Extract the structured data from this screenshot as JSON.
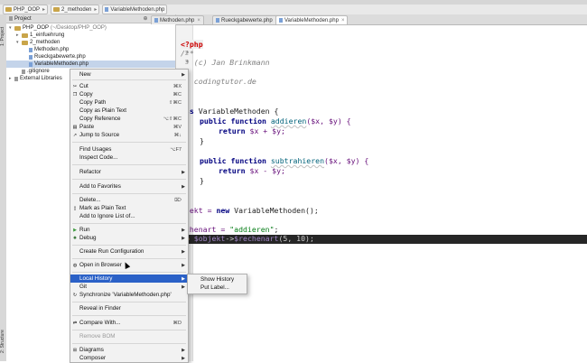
{
  "breadcrumbs": [
    "PHP_OOP",
    "2_methoden",
    "VariableMethoden.php"
  ],
  "project_panel": {
    "header": "Project",
    "tree": [
      {
        "label": "PHP_OOP",
        "path": "(~/Desktop/PHP_OOP)"
      },
      {
        "label": "1_einfuehrung",
        "path": ""
      },
      {
        "label": "2_methoden",
        "path": ""
      },
      {
        "label": "Methoden.php",
        "path": ""
      },
      {
        "label": "Rueckgabewerte.php",
        "path": ""
      },
      {
        "label": "VariableMethoden.php",
        "path": ""
      },
      {
        "label": ".gitignore",
        "path": ""
      },
      {
        "label": "External Libraries",
        "path": ""
      }
    ]
  },
  "left_strip": {
    "top_tab": "1: Project",
    "bottom_tab": "2: Structure"
  },
  "tabs": [
    "Methoden.php",
    "Rueckgabewerte.php",
    "VariableMethoden.php"
  ],
  "editor": {
    "line_numbers": [
      "1",
      "2",
      "3",
      "4"
    ],
    "line_comment_author": " * (c) Jan Brinkmann",
    "line_comment_site": " * codingtutor.de",
    "line_comment_close": "*/",
    "frag_class": "ass ",
    "class_name": "VariableMethoden",
    "brace_open": " {",
    "public_function": "public function ",
    "fn_add": "addieren",
    "fn_sub": "subtrahieren",
    "params": "($x, $y) {",
    "return_kw": "return ",
    "expr_add": "$x + $y;",
    "expr_sub": "$x - $y;",
    "brace_close": "}",
    "new_obj_lhs": "bjekt = ",
    "new_kw": "new ",
    "new_obj_rhs": "VariableMethoden();",
    "rechenart_lhs": "echenart = ",
    "rechenart_val": "\"addieren\"",
    "rechenart_end": ";",
    "echo_line_prefix": "ho ",
    "echo_line_var": "$objekt",
    "echo_line_arrow": "->",
    "echo_line_call": "$rechenart",
    "echo_line_args": "(5, 10);",
    "php_open": "<?php",
    "comment_open": "/**"
  },
  "context_menu": {
    "items": [
      {
        "label": "New",
        "shortcut": "",
        "submenu": true
      },
      {
        "label": "Cut",
        "shortcut": "⌘X"
      },
      {
        "label": "Copy",
        "shortcut": "⌘C"
      },
      {
        "label": "Copy Path",
        "shortcut": "⇧⌘C"
      },
      {
        "label": "Copy as Plain Text",
        "shortcut": ""
      },
      {
        "label": "Copy Reference",
        "shortcut": "⌥⇧⌘C"
      },
      {
        "label": "Paste",
        "shortcut": "⌘V"
      },
      {
        "label": "Jump to Source",
        "shortcut": "⌘↓"
      },
      {
        "label": "Find Usages",
        "shortcut": "⌥F7"
      },
      {
        "label": "Inspect Code...",
        "shortcut": ""
      },
      {
        "label": "Refactor",
        "shortcut": "",
        "submenu": true
      },
      {
        "label": "Add to Favorites",
        "shortcut": "",
        "submenu": true
      },
      {
        "label": "Delete...",
        "shortcut": "⌦"
      },
      {
        "label": "Mark as Plain Text",
        "shortcut": ""
      },
      {
        "label": "Add to Ignore List of...",
        "shortcut": ""
      },
      {
        "label": "Run",
        "shortcut": "",
        "submenu": true
      },
      {
        "label": "Debug",
        "shortcut": "",
        "submenu": true
      },
      {
        "label": "Create Run Configuration",
        "shortcut": "",
        "submenu": true
      },
      {
        "label": "Open in Browser",
        "shortcut": "",
        "submenu": true
      },
      {
        "label": "Local History",
        "shortcut": "",
        "submenu": true
      },
      {
        "label": "Git",
        "shortcut": "",
        "submenu": true
      },
      {
        "label": "Synchronize 'VariableMethoden.php'",
        "shortcut": ""
      },
      {
        "label": "Reveal in Finder",
        "shortcut": ""
      },
      {
        "label": "Compare With...",
        "shortcut": "⌘D"
      },
      {
        "label": "Remove BOM",
        "shortcut": ""
      },
      {
        "label": "Diagrams",
        "shortcut": "",
        "submenu": true
      },
      {
        "label": "Composer",
        "shortcut": "",
        "submenu": true
      }
    ]
  },
  "local_history_submenu": [
    "Show History",
    "Put Label..."
  ],
  "colors": {
    "menu_highlight": "#2b61c7",
    "selection_row": "#c4d4ea",
    "highlighted_line_bg": "#262626"
  }
}
